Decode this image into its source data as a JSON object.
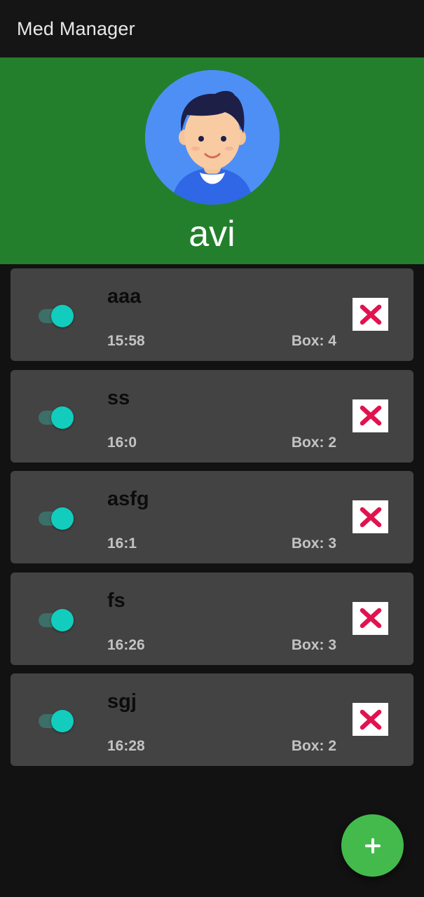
{
  "app": {
    "title": "Med Manager"
  },
  "profile": {
    "name": "avi"
  },
  "medications": [
    {
      "name": "aaa",
      "time": "15:58",
      "box": "Box: 4",
      "enabled": true
    },
    {
      "name": "ss",
      "time": "16:0",
      "box": "Box: 2",
      "enabled": true
    },
    {
      "name": "asfg",
      "time": "16:1",
      "box": "Box: 3",
      "enabled": true
    },
    {
      "name": "fs",
      "time": "16:26",
      "box": "Box: 3",
      "enabled": true
    },
    {
      "name": "sgj",
      "time": "16:28",
      "box": "Box: 2",
      "enabled": true
    }
  ],
  "icons": {
    "delete": "close-icon",
    "add": "plus-icon",
    "avatar": "user-avatar-icon"
  },
  "colors": {
    "header_green": "#237f2b",
    "card_background": "#434343",
    "toggle_accent": "#12cdbd",
    "delete_mark": "#e0134f",
    "fab_green": "#44ba4c"
  }
}
